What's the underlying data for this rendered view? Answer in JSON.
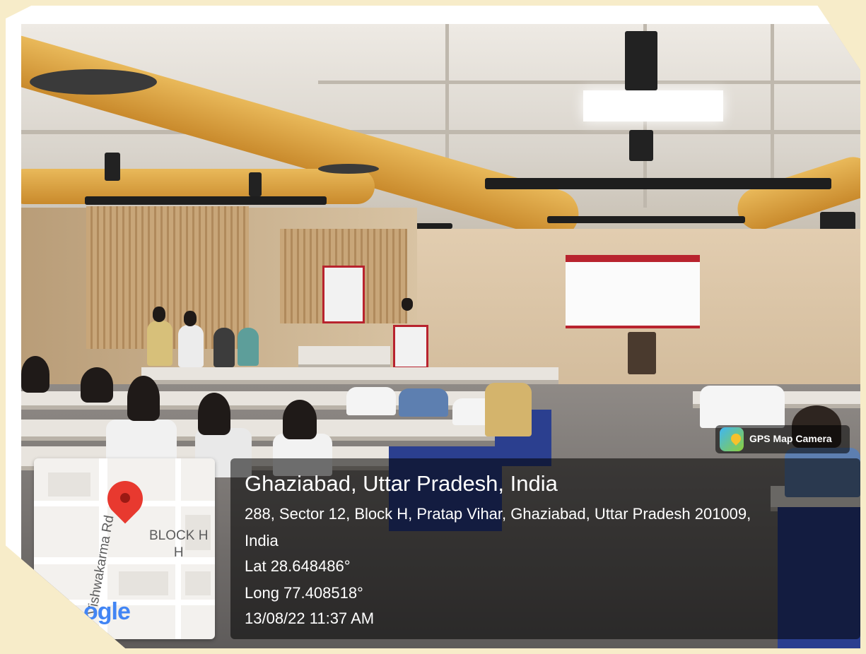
{
  "location": {
    "title": "Ghaziabad, Uttar Pradesh, India",
    "address_line1": "288, Sector 12, Block H, Pratap Vihar, Ghaziabad, Uttar Pradesh 201009,",
    "address_line2": "India",
    "lat": "Lat 28.648486°",
    "long": "Long 77.408518°",
    "timestamp": "13/08/22 11:37 AM"
  },
  "map": {
    "road_label": "Vishwakarma Rd",
    "block_label_line1": "BLOCK H",
    "block_label_line2": "H",
    "logo_text": "ogle",
    "pin_icon": "map-pin-icon"
  },
  "badge": {
    "label": "GPS Map Camera",
    "icon": "gps-map-camera-icon"
  },
  "colors": {
    "frame_bg": "#f7ecc9",
    "pin": "#e8392f",
    "banner_accent": "#b8232e"
  }
}
